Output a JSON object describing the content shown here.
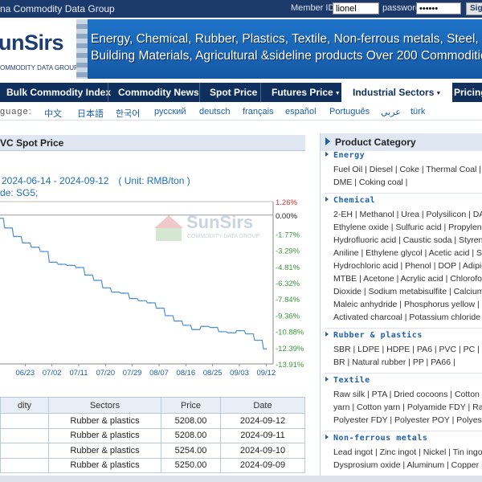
{
  "topbar": {
    "title": "na Commodity Data Group",
    "member_label": "Member ID:",
    "member_value": "lionel",
    "password_label": "password:",
    "password_value": "••••••",
    "signin_label": "Sig"
  },
  "logo": {
    "name": "unSirs",
    "tagline": "OMMODITY DATA GROUP"
  },
  "banner": {
    "line1": "Energy, Chemical, Rubber, Plastics, Textile, Non-ferrous metals, Steel,",
    "line2": "Building Materials, Agricultural &sideline products    Over 200 Commodities"
  },
  "nav": {
    "items": [
      "Bulk Commodity Index",
      "Commodity News",
      "Spot Price",
      "Futures Price",
      "Industrial Sectors",
      "Pricing"
    ]
  },
  "languages": {
    "label": "guage:",
    "items": [
      "中文",
      "日本語",
      "한국어",
      "русский",
      "deutsch",
      "français",
      "español",
      "Português",
      "عربي",
      "türk"
    ]
  },
  "section_title": "VC Spot Price",
  "date_range": "2024-06-14 - 2024-09-12　( Unit: RMB/ton )",
  "grade": "de: SG5;",
  "watermark": {
    "main": "SunSirs",
    "sub": "COMMODITY DATA GROUP"
  },
  "chart_data": {
    "type": "line",
    "title": "",
    "xlabel": "",
    "ylabel": "",
    "x_ticks": [
      "06/23",
      "07/02",
      "07/11",
      "07/20",
      "07/29",
      "08/07",
      "08/16",
      "08/25",
      "09/03",
      "09/12"
    ],
    "y_ticks": [
      "1.26%",
      "0.00%",
      "-1.77%",
      "-3.29%",
      "-4.81%",
      "-6.32%",
      "-7.84%",
      "-9.36%",
      "-10.88%",
      "-12.39%",
      "-13.91%"
    ],
    "ylim": [
      -13.91,
      1.26
    ],
    "series": [
      {
        "x": [
          "06/14",
          "06/17",
          "06/20",
          "06/23",
          "06/26",
          "06/29",
          "07/02",
          "07/05",
          "07/08",
          "07/11",
          "07/14",
          "07/17",
          "07/20",
          "07/23",
          "07/26",
          "07/29",
          "08/01",
          "08/04",
          "08/07",
          "08/10",
          "08/13",
          "08/16",
          "08/19",
          "08/22",
          "08/25",
          "08/28",
          "08/31",
          "09/03",
          "09/06",
          "09/09",
          "09/12"
        ],
        "values": [
          -0.3,
          -1.2,
          -2.0,
          -2.6,
          -3.0,
          -3.4,
          -4.4,
          -4.6,
          -4.7,
          -4.9,
          -5.6,
          -6.1,
          -6.8,
          -7.2,
          -7.3,
          -7.8,
          -8.0,
          -8.2,
          -8.7,
          -9.4,
          -9.9,
          -10.3,
          -10.7,
          -10.4,
          -10.5,
          -10.9,
          -11.0,
          -10.8,
          -11.1,
          -11.7,
          -12.5
        ],
        "color": "#4a90d9"
      }
    ],
    "zero_line": true,
    "grid": false
  },
  "table": {
    "headers": [
      "dity",
      "Sectors",
      "Price",
      "Date"
    ],
    "rows": [
      [
        "",
        "Rubber & plastics",
        "5208.00",
        "2024-09-12"
      ],
      [
        "",
        "Rubber & plastics",
        "5208.00",
        "2024-09-11"
      ],
      [
        "",
        "Rubber & plastics",
        "5254.00",
        "2024-09-10"
      ],
      [
        "",
        "Rubber & plastics",
        "5250.00",
        "2024-09-09"
      ]
    ]
  },
  "product_category": {
    "title": "Product Category",
    "groups": [
      {
        "name": "Energy",
        "lines": [
          "Fuel Oil | Diesel | Coke | Thermal Coal |",
          "DME | Coking coal |"
        ]
      },
      {
        "name": "Chemical",
        "lines": [
          "2-EH | Methanol | Urea | Polysilicon | DA",
          "Ethylene oxide | Sulfuric acid | Propylene",
          "Hydrofluoric acid | Caustic soda | Styrene",
          "Aniline | Ethylene glycol | Acetic acid | So",
          "Hydrochloric acid | Phenol | DOP | Adipic",
          "MTBE | Acetone | Acrylic acid | Chlorofor",
          "Dioxide | Sodium metabisulfite | Calcium c",
          "Maleic anhydride | Phosphorus yellow | Ni",
          "Activated charcoal | Potassium chloride | X"
        ]
      },
      {
        "name": "Rubber & plastics",
        "lines": [
          "SBR | LDPE | HDPE | PA6 | PVC | PC |",
          "BR | Natural rubber | PP | PA66 |"
        ]
      },
      {
        "name": "Textile",
        "lines": [
          "Raw silk | PTA | Dried cocoons | Cotton L",
          "yarn | Cotton yarn | Polyamide FDY | Ray",
          "Polyester FDY | Polyester POY | Polyeste"
        ]
      },
      {
        "name": "Non-ferrous metals",
        "lines": [
          "Lead ingot | Zinc ingot | Nickel | Tin ingo",
          "Dysprosium oxide | Aluminum | Copper |"
        ]
      }
    ]
  }
}
